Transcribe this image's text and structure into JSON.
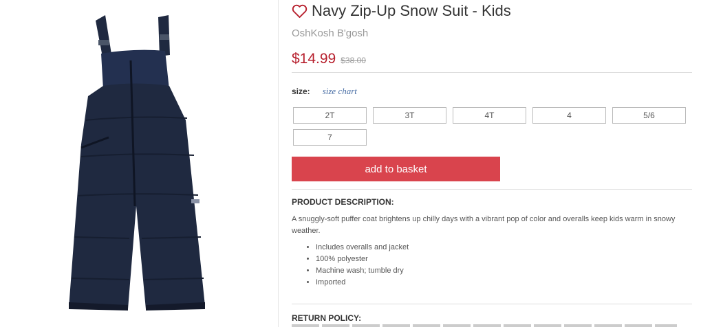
{
  "product": {
    "title": "Navy Zip-Up Snow Suit - Kids",
    "brand": "OshKosh B'gosh",
    "price": "$14.99",
    "original_price": "$38.00",
    "image_icon": "snow-overalls-image",
    "colors": {
      "sale_price": "#b7202e",
      "button": "#d9444d",
      "garment": "#1f2940"
    }
  },
  "size": {
    "label": "size:",
    "chart_link": "size chart",
    "options": [
      "2T",
      "3T",
      "4T",
      "4",
      "5/6",
      "7"
    ]
  },
  "actions": {
    "add_to_basket": "add to basket"
  },
  "description": {
    "heading": "PRODUCT DESCRIPTION:",
    "text": "A snuggly-soft puffer coat brightens up chilly days with a vibrant pop of color and overalls keep kids warm in snowy weather.",
    "bullets": [
      "Includes overalls and jacket",
      "100% polyester",
      "Machine wash; tumble dry",
      "Imported"
    ]
  },
  "return_policy": {
    "heading": "RETURN POLICY:"
  }
}
